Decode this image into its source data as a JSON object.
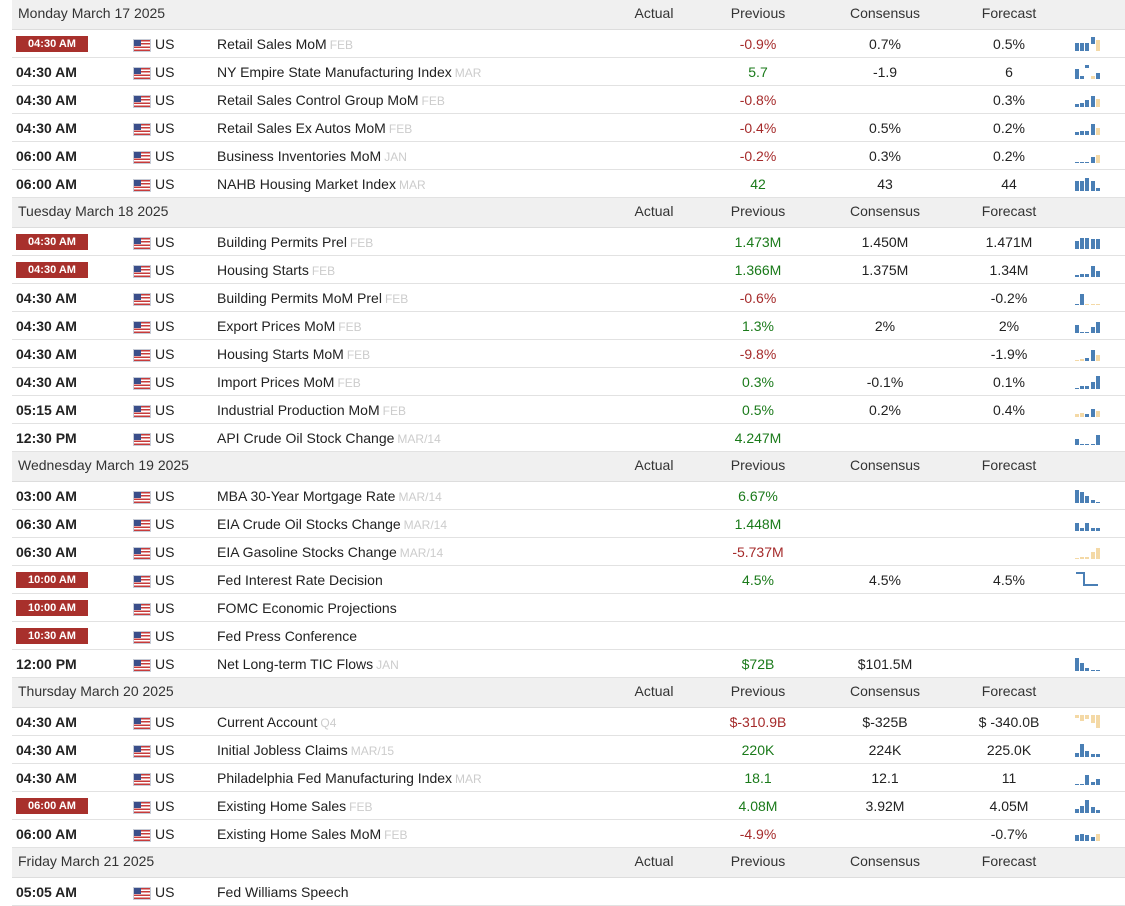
{
  "columns": {
    "actual": "Actual",
    "previous": "Previous",
    "consensus": "Consensus",
    "forecast": "Forecast"
  },
  "days": [
    {
      "date": "Monday March 17 2025",
      "events": [
        {
          "time": "04:30 AM",
          "highlight": true,
          "country": "US",
          "name": "Retail Sales MoM",
          "ref": "FEB",
          "actual": "",
          "previous": "-0.9%",
          "prev_trend": "neg",
          "consensus": "0.7%",
          "forecast": "0.5%",
          "spark": [
            60,
            60,
            60,
            -50,
            80
          ],
          "spark_forecast": [
            0,
            0,
            0,
            0,
            1
          ]
        },
        {
          "time": "04:30 AM",
          "highlight": false,
          "country": "US",
          "name": "NY Empire State Manufacturing Index",
          "ref": "MAR",
          "actual": "",
          "previous": "5.7",
          "prev_trend": "pos",
          "consensus": "-1.9",
          "forecast": "6",
          "spark": [
            70,
            20,
            -20,
            20,
            40
          ],
          "spark_forecast": [
            0,
            0,
            0,
            1,
            0
          ]
        },
        {
          "time": "04:30 AM",
          "highlight": false,
          "country": "US",
          "name": "Retail Sales Control Group MoM",
          "ref": "FEB",
          "actual": "",
          "previous": "-0.8%",
          "prev_trend": "neg",
          "consensus": "",
          "forecast": "0.3%",
          "spark": [
            20,
            30,
            50,
            80,
            60
          ],
          "spark_forecast": [
            0,
            0,
            0,
            0,
            1
          ]
        },
        {
          "time": "04:30 AM",
          "highlight": false,
          "country": "US",
          "name": "Retail Sales Ex Autos MoM",
          "ref": "FEB",
          "actual": "",
          "previous": "-0.4%",
          "prev_trend": "neg",
          "consensus": "0.5%",
          "forecast": "0.2%",
          "spark": [
            20,
            30,
            30,
            80,
            50
          ],
          "spark_forecast": [
            0,
            0,
            0,
            0,
            1
          ]
        },
        {
          "time": "06:00 AM",
          "highlight": false,
          "country": "US",
          "name": "Business Inventories MoM",
          "ref": "JAN",
          "actual": "",
          "previous": "-0.2%",
          "prev_trend": "neg",
          "consensus": "0.3%",
          "forecast": "0.2%",
          "spark": [
            0,
            0,
            0,
            40,
            60
          ],
          "spark_forecast": [
            0,
            0,
            0,
            0,
            1
          ]
        },
        {
          "time": "06:00 AM",
          "highlight": false,
          "country": "US",
          "name": "NAHB Housing Market Index",
          "ref": "MAR",
          "actual": "",
          "previous": "42",
          "prev_trend": "pos",
          "consensus": "43",
          "forecast": "44",
          "spark": [
            70,
            70,
            90,
            70,
            20
          ],
          "spark_forecast": [
            0,
            0,
            0,
            0,
            0
          ]
        }
      ]
    },
    {
      "date": "Tuesday March 18 2025",
      "events": [
        {
          "time": "04:30 AM",
          "highlight": true,
          "country": "US",
          "name": "Building Permits Prel",
          "ref": "FEB",
          "actual": "",
          "previous": "1.473M",
          "prev_trend": "pos",
          "consensus": "1.450M",
          "forecast": "1.471M",
          "spark": [
            60,
            80,
            80,
            70,
            70
          ],
          "spark_forecast": [
            0,
            0,
            0,
            0,
            0
          ]
        },
        {
          "time": "04:30 AM",
          "highlight": true,
          "country": "US",
          "name": "Housing Starts",
          "ref": "FEB",
          "actual": "",
          "previous": "1.366M",
          "prev_trend": "pos",
          "consensus": "1.375M",
          "forecast": "1.34M",
          "spark": [
            15,
            20,
            20,
            80,
            40
          ],
          "spark_forecast": [
            0,
            0,
            0,
            0,
            0
          ]
        },
        {
          "time": "04:30 AM",
          "highlight": false,
          "country": "US",
          "name": "Building Permits MoM Prel",
          "ref": "FEB",
          "actual": "",
          "previous": "-0.6%",
          "prev_trend": "neg",
          "consensus": "",
          "forecast": "-0.2%",
          "spark": [
            0,
            80,
            10,
            10,
            10
          ],
          "spark_forecast": [
            0,
            0,
            1,
            1,
            1
          ]
        },
        {
          "time": "04:30 AM",
          "highlight": false,
          "country": "US",
          "name": "Export Prices MoM",
          "ref": "FEB",
          "actual": "",
          "previous": "1.3%",
          "prev_trend": "pos",
          "consensus": "2%",
          "forecast": "2%",
          "spark": [
            60,
            0,
            0,
            40,
            80
          ],
          "spark_forecast": [
            0,
            0,
            0,
            0,
            0
          ]
        },
        {
          "time": "04:30 AM",
          "highlight": false,
          "country": "US",
          "name": "Housing Starts MoM",
          "ref": "FEB",
          "actual": "",
          "previous": "-9.8%",
          "prev_trend": "neg",
          "consensus": "",
          "forecast": "-1.9%",
          "spark": [
            10,
            15,
            20,
            80,
            40
          ],
          "spark_forecast": [
            1,
            1,
            0,
            0,
            1
          ]
        },
        {
          "time": "04:30 AM",
          "highlight": false,
          "country": "US",
          "name": "Import Prices MoM",
          "ref": "FEB",
          "actual": "",
          "previous": "0.3%",
          "prev_trend": "pos",
          "consensus": "-0.1%",
          "forecast": "0.1%",
          "spark": [
            10,
            20,
            20,
            50,
            90
          ],
          "spark_forecast": [
            0,
            0,
            0,
            0,
            0
          ]
        },
        {
          "time": "05:15 AM",
          "highlight": false,
          "country": "US",
          "name": "Industrial Production MoM",
          "ref": "FEB",
          "actual": "",
          "previous": "0.5%",
          "prev_trend": "pos",
          "consensus": "0.2%",
          "forecast": "0.4%",
          "spark": [
            20,
            30,
            20,
            60,
            40
          ],
          "spark_forecast": [
            1,
            1,
            0,
            0,
            1
          ]
        },
        {
          "time": "12:30 PM",
          "highlight": false,
          "country": "US",
          "name": "API Crude Oil Stock Change",
          "ref": "MAR/14",
          "actual": "",
          "previous": "4.247M",
          "prev_trend": "pos",
          "consensus": "",
          "forecast": "",
          "spark": [
            40,
            10,
            0,
            10,
            70
          ],
          "spark_forecast": [
            0,
            0,
            0,
            0,
            0
          ]
        }
      ]
    },
    {
      "date": "Wednesday March 19 2025",
      "events": [
        {
          "time": "03:00 AM",
          "highlight": false,
          "country": "US",
          "name": "MBA 30-Year Mortgage Rate",
          "ref": "MAR/14",
          "actual": "",
          "previous": "6.67%",
          "prev_trend": "pos",
          "consensus": "",
          "forecast": "",
          "spark": [
            90,
            80,
            50,
            20,
            10
          ],
          "spark_forecast": [
            0,
            0,
            0,
            0,
            0
          ]
        },
        {
          "time": "06:30 AM",
          "highlight": false,
          "country": "US",
          "name": "EIA Crude Oil Stocks Change",
          "ref": "MAR/14",
          "actual": "",
          "previous": "1.448M",
          "prev_trend": "pos",
          "consensus": "",
          "forecast": "",
          "spark": [
            60,
            20,
            60,
            20,
            20
          ],
          "spark_forecast": [
            0,
            0,
            0,
            0,
            0
          ]
        },
        {
          "time": "06:30 AM",
          "highlight": false,
          "country": "US",
          "name": "EIA Gasoline Stocks Change",
          "ref": "MAR/14",
          "actual": "",
          "previous": "-5.737M",
          "prev_trend": "neg",
          "consensus": "",
          "forecast": "",
          "spark": [
            10,
            15,
            15,
            50,
            80
          ],
          "spark_forecast": [
            1,
            1,
            1,
            1,
            1
          ]
        },
        {
          "time": "10:00 AM",
          "highlight": true,
          "country": "US",
          "name": "Fed Interest Rate Decision",
          "ref": "",
          "actual": "",
          "previous": "4.5%",
          "prev_trend": "pos",
          "consensus": "4.5%",
          "forecast": "4.5%",
          "spark": [],
          "spark_forecast": [],
          "step_spark": true
        },
        {
          "time": "10:00 AM",
          "highlight": true,
          "country": "US",
          "name": "FOMC Economic Projections",
          "ref": "",
          "actual": "",
          "previous": "",
          "prev_trend": "neu",
          "consensus": "",
          "forecast": "",
          "spark": [],
          "spark_forecast": []
        },
        {
          "time": "10:30 AM",
          "highlight": true,
          "country": "US",
          "name": "Fed Press Conference",
          "ref": "",
          "actual": "",
          "previous": "",
          "prev_trend": "neu",
          "consensus": "",
          "forecast": "",
          "spark": [],
          "spark_forecast": []
        },
        {
          "time": "12:00 PM",
          "highlight": false,
          "country": "US",
          "name": "Net Long-term TIC Flows",
          "ref": "JAN",
          "actual": "",
          "previous": "$72B",
          "prev_trend": "pos",
          "consensus": "$101.5M",
          "forecast": "",
          "spark": [
            90,
            60,
            20,
            10,
            10
          ],
          "spark_forecast": [
            0,
            0,
            0,
            0,
            0
          ]
        }
      ]
    },
    {
      "date": "Thursday March 20 2025",
      "events": [
        {
          "time": "04:30 AM",
          "highlight": false,
          "country": "US",
          "name": "Current Account",
          "ref": "Q4",
          "actual": "",
          "previous": "$-310.9B",
          "prev_trend": "neg",
          "consensus": "$-325B",
          "forecast": "$ -340.0B",
          "spark": [
            -20,
            -40,
            -30,
            -60,
            -90
          ],
          "spark_forecast": [
            1,
            1,
            1,
            1,
            1
          ]
        },
        {
          "time": "04:30 AM",
          "highlight": false,
          "country": "US",
          "name": "Initial Jobless Claims",
          "ref": "MAR/15",
          "actual": "",
          "previous": "220K",
          "prev_trend": "pos",
          "consensus": "224K",
          "forecast": "225.0K",
          "spark": [
            30,
            90,
            40,
            20,
            20
          ],
          "spark_forecast": [
            0,
            0,
            0,
            0,
            0
          ]
        },
        {
          "time": "04:30 AM",
          "highlight": false,
          "country": "US",
          "name": "Philadelphia Fed Manufacturing Index",
          "ref": "MAR",
          "actual": "",
          "previous": "18.1",
          "prev_trend": "pos",
          "consensus": "12.1",
          "forecast": "11",
          "spark": [
            10,
            10,
            70,
            20,
            40
          ],
          "spark_forecast": [
            0,
            0,
            0,
            0,
            0
          ]
        },
        {
          "time": "06:00 AM",
          "highlight": true,
          "country": "US",
          "name": "Existing Home Sales",
          "ref": "FEB",
          "actual": "",
          "previous": "4.08M",
          "prev_trend": "pos",
          "consensus": "3.92M",
          "forecast": "4.05M",
          "spark": [
            30,
            50,
            90,
            40,
            20
          ],
          "spark_forecast": [
            0,
            0,
            0,
            0,
            0
          ]
        },
        {
          "time": "06:00 AM",
          "highlight": false,
          "country": "US",
          "name": "Existing Home Sales MoM",
          "ref": "FEB",
          "actual": "",
          "previous": "-4.9%",
          "prev_trend": "neg",
          "consensus": "",
          "forecast": "-0.7%",
          "spark": [
            40,
            50,
            40,
            30,
            50
          ],
          "spark_forecast": [
            0,
            0,
            0,
            0,
            1
          ]
        }
      ]
    },
    {
      "date": "Friday March 21 2025",
      "events": [
        {
          "time": "05:05 AM",
          "highlight": false,
          "country": "US",
          "name": "Fed Williams Speech",
          "ref": "",
          "actual": "",
          "previous": "",
          "prev_trend": "neu",
          "consensus": "",
          "forecast": "",
          "spark": [],
          "spark_forecast": []
        }
      ]
    }
  ]
}
